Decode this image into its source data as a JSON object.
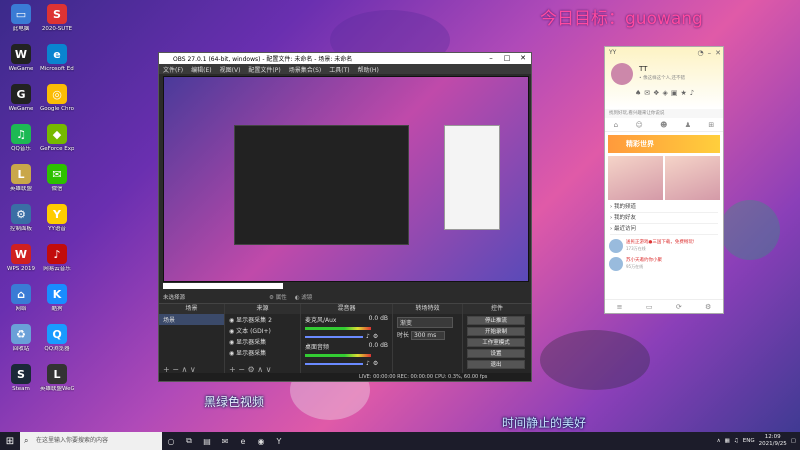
{
  "overlay": {
    "banner": "今日目标：guowang",
    "subtitle_left": "黑绿色视频",
    "subtitle_right": "时间静止的美好"
  },
  "desktop_icons": [
    {
      "label": "此电脑",
      "color": "#3a7bd5",
      "glyph": "▭"
    },
    {
      "label": "2020-SUTE",
      "color": "#d33",
      "glyph": "S"
    },
    {
      "label": "WeGame",
      "color": "#222",
      "glyph": "W"
    },
    {
      "label": "Microsoft Edge",
      "color": "#0a84d0",
      "glyph": "e"
    },
    {
      "label": "WeGame",
      "color": "#222",
      "glyph": "G"
    },
    {
      "label": "Google Chrome",
      "color": "#fbbc05",
      "glyph": "◎"
    },
    {
      "label": "QQ音乐",
      "color": "#1db954",
      "glyph": "♫"
    },
    {
      "label": "GeForce Experience",
      "color": "#76b900",
      "glyph": "◆"
    },
    {
      "label": "英雄联盟",
      "color": "#c9a74a",
      "glyph": "L"
    },
    {
      "label": "微信",
      "color": "#2dc100",
      "glyph": "✉"
    },
    {
      "label": "控制面板",
      "color": "#3a6ea5",
      "glyph": "⚙"
    },
    {
      "label": "YY语音",
      "color": "#ffcc00",
      "glyph": "Y"
    },
    {
      "label": "WPS 2019",
      "color": "#d02020",
      "glyph": "W"
    },
    {
      "label": "网易云音乐",
      "color": "#c20c0c",
      "glyph": "♪"
    },
    {
      "label": "网络",
      "color": "#3a7bd5",
      "glyph": "⌂"
    },
    {
      "label": "酷狗",
      "color": "#1a8cff",
      "glyph": "K"
    },
    {
      "label": "回收站",
      "color": "#6aa0d8",
      "glyph": "♻"
    },
    {
      "label": "QQ浏览器",
      "color": "#1a9bff",
      "glyph": "Q"
    },
    {
      "label": "Steam",
      "color": "#1b2838",
      "glyph": "S"
    },
    {
      "label": "英雄联盟WeGame",
      "color": "#333",
      "glyph": "L"
    }
  ],
  "obs": {
    "title": "OBS 27.0.1 (64-bit, windows) - 配置文件: 未命名 - 场景: 未命名",
    "menu": [
      "文件(F)",
      "编辑(E)",
      "视图(V)",
      "配置文件(P)",
      "场景集合(S)",
      "工具(T)",
      "帮助(H)"
    ],
    "unsaved_label": "未选择源",
    "props_label": "属性",
    "filters_label": "滤镜",
    "panels": {
      "scenes_title": "场景",
      "sources_title": "来源",
      "mixer_title": "混音器",
      "transitions_title": "转场特效",
      "controls_title": "控件"
    },
    "scenes": [
      "场景"
    ],
    "sources": [
      "显示器采集 2",
      "文本 (GDI+)",
      "显示器采集",
      "显示器采集"
    ],
    "mixer": [
      {
        "name": "麦克风/Aux",
        "db": "0.0 dB"
      },
      {
        "name": "桌面音频",
        "db": "0.0 dB"
      }
    ],
    "transition": {
      "type": "渐变",
      "duration_label": "时长",
      "duration": "300 ms"
    },
    "controls": [
      "停止推流",
      "开始录制",
      "工作室模式",
      "设置",
      "退出"
    ],
    "status": "LIVE: 00:00:00   REC: 00:00:00   CPU: 0.3%, 60.00 fps"
  },
  "yy": {
    "app": "YY",
    "name": "TT",
    "signature": "• 像这样这个人,还不错",
    "search": "找到好玩,看兴趣来让你说说",
    "banner": "精彩世界",
    "list": [
      "我的频道",
      "我的好友",
      "最近访问"
    ],
    "items": [
      {
        "title": "送民正游戏●三国下载，免费畅玩!",
        "meta": "173万在线"
      },
      {
        "title": "苏小天邀约你小聚",
        "meta": "95万在线"
      }
    ]
  },
  "taskbar": {
    "search_placeholder": "在这里输入你要搜索的内容",
    "lang": "ENG",
    "time": "12:09",
    "date": "2021/9/25"
  }
}
